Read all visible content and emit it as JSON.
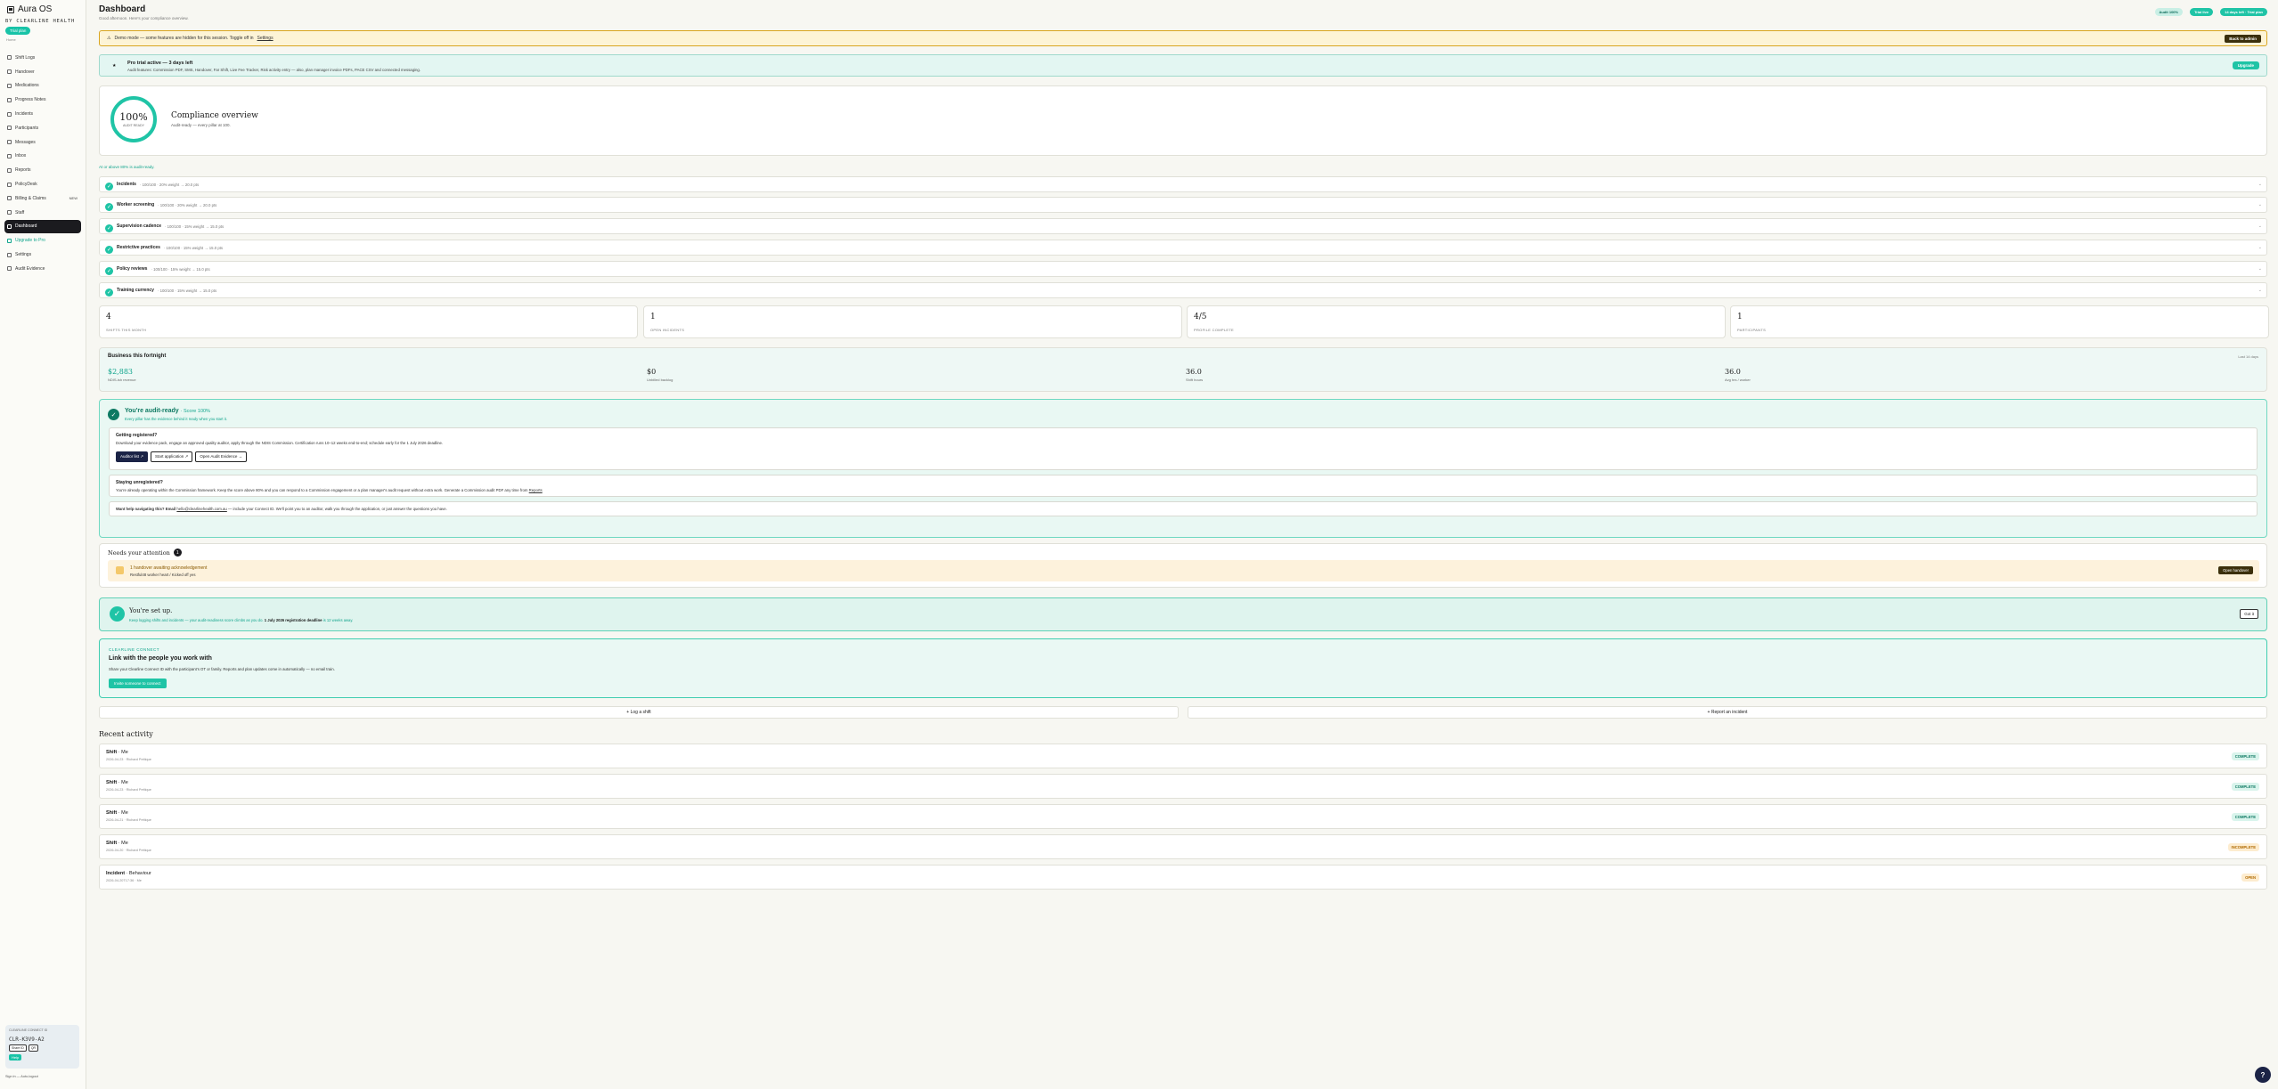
{
  "app": {
    "name": "Aura OS",
    "org": "BY CLEARLINE HEALTH",
    "trial_chip": "Trial plan",
    "section": "Home"
  },
  "sidebar": {
    "items": [
      {
        "label": "Shift Logs"
      },
      {
        "label": "Handover"
      },
      {
        "label": "Medications"
      },
      {
        "label": "Progress Notes"
      },
      {
        "label": "Incidents"
      },
      {
        "label": "Participants"
      },
      {
        "label": "Messages"
      },
      {
        "label": "Inbox"
      },
      {
        "label": "Reports"
      },
      {
        "label": "PolicyDesk"
      },
      {
        "label": "Billing & Claims",
        "badge": "NEW"
      },
      {
        "label": "Staff"
      },
      {
        "label": "Dashboard"
      },
      {
        "label": "Upgrade to Pro"
      },
      {
        "label": "Settings"
      },
      {
        "label": "Audit Evidence"
      }
    ],
    "connect_card": {
      "label": "CLEARLINE CONNECT ID",
      "id": "CLR-K3V9-A2",
      "copy": "Share ID",
      "qr": "QR",
      "help": "Help"
    },
    "footer": "Sign in — Auto-logout"
  },
  "header": {
    "title": "Dashboard",
    "subtitle": "Good afternoon. Here's your compliance overview.",
    "chips": [
      "Audit 100%",
      "Trial live",
      "14 days left · Trial plan"
    ]
  },
  "warning_banner": {
    "text": "Demo mode — some features are hidden for this session. Toggle off in",
    "link": "Settings",
    "button": "Back to admin"
  },
  "trial_banner": {
    "star": "★",
    "title": "Pro trial active — 3 days left",
    "body": "Audit features: Commission PDF, SMS, Handover, Far Shift, Live Fee Tracker, Risk activity entry — also, plan manager invoice PDFs, PACE CSV and connected messaging.",
    "button": "Upgrade"
  },
  "overview": {
    "pct": "100%",
    "ring_label": "AUDIT READY",
    "title": "Compliance overview",
    "subtitle": "Audit-ready — every pillar at 100."
  },
  "above_note": "At or above 80% is audit-ready.",
  "criteria": [
    {
      "name": "Incidents",
      "meta": "· 100/100 · 20% weight → 20.0 pts"
    },
    {
      "name": "Worker screening",
      "meta": "· 100/100 · 20% weight → 20.0 pts"
    },
    {
      "name": "Supervision cadence",
      "meta": "· 100/100 · 15% weight → 15.0 pts"
    },
    {
      "name": "Restrictive practices",
      "meta": "· 100/100 · 15% weight → 15.0 pts"
    },
    {
      "name": "Policy reviews",
      "meta": "· 100/100 · 15% weight → 15.0 pts"
    },
    {
      "name": "Training currency",
      "meta": "· 100/100 · 15% weight → 15.0 pts"
    }
  ],
  "stats": [
    {
      "value": "4",
      "label": "SHIFTS THIS MONTH"
    },
    {
      "value": "1",
      "label": "OPEN INCIDENTS"
    },
    {
      "value": "4/5",
      "label": "PROFILE COMPLETE"
    },
    {
      "value": "1",
      "label": "PARTICIPANTS"
    }
  ],
  "business": {
    "title": "Business this fortnight",
    "range": "Last 14 days",
    "cells": [
      {
        "value": "$2,883",
        "label": "NDIS-ish revenue"
      },
      {
        "value": "$0",
        "label": "Unbilled backlog"
      },
      {
        "value": "36.0",
        "label": "Shift hours"
      },
      {
        "value": "36.0",
        "label": "Avg hrs / worker"
      }
    ]
  },
  "audit_ready": {
    "check": "✓",
    "title": "You're audit-ready",
    "score": "· Score 100%",
    "subtitle": "Every pillar has the evidence behind it ready when you start it.",
    "box1": {
      "title": "Getting registered?",
      "body": "Download your evidence pack, engage an approved quality auditor, apply through the NDIS Commission. Certification runs 10–12 weeks end-to-end; schedule early for the 1 July 2026 deadline.",
      "buttons": [
        "Auditor list ↗",
        "Start application ↗",
        "Open Audit Evidence →"
      ]
    },
    "box2": {
      "title": "Staying unregistered?",
      "body": "You're already operating within the Commission framework. Keep the score above 80% and you can respond to a Commission engagement or a plan manager's audit request without extra work. Generate a Commission audit PDF any time from",
      "link": "Reports"
    },
    "box3": {
      "prefix": "Want help navigating this? Email",
      "email": "hello@clearlinehealth.com.au",
      "suffix": "— include your Connect ID. We'll point you to an auditor, walk you through the application, or just answer the questions you have."
    }
  },
  "attention": {
    "title": "Needs your attention",
    "count": "1",
    "item_title": "1 handover awaiting acknowledgement",
    "item_sub": "Restful48 worker heart / Kicked off yes",
    "button": "Open handover"
  },
  "setup": {
    "check": "✓",
    "title": "You're set up.",
    "body_pre": "Keep logging shifts and incidents — your audit-readiness score climbs as you do.",
    "body_bold": "1 July 2026 registration deadline",
    "body_post": "is 12 weeks away.",
    "button": "Got it"
  },
  "connect": {
    "kicker": "CLEARLINE CONNECT",
    "title": "Link with the people you work with",
    "body": "Share your Clearline Connect ID with the participant's OT or family. Reports and plan updates come in automatically — no email train.",
    "button": "Invite someone to connect"
  },
  "quick": {
    "log": "+ Log a shift",
    "report": "+ Report an incident"
  },
  "recent": {
    "title": "Recent activity",
    "items": [
      {
        "type": "Shift",
        "who": "· Me",
        "meta": "2026-04-23 · Richard Pettique",
        "status": "COMPLETE",
        "cls": "complete"
      },
      {
        "type": "Shift",
        "who": "· Me",
        "meta": "2026-04-23 · Richard Pettique",
        "status": "COMPLETE",
        "cls": "complete"
      },
      {
        "type": "Shift",
        "who": "· Me",
        "meta": "2026-04-21 · Richard Pettique",
        "status": "COMPLETE",
        "cls": "complete"
      },
      {
        "type": "Shift",
        "who": "· Me",
        "meta": "2026-04-20 · Richard Pettique",
        "status": "INCOMPLETE",
        "cls": "incomplete"
      },
      {
        "type": "Incident",
        "who": "· Behaviour",
        "meta": "2026-04-20T17:36 · Me",
        "status": "OPEN",
        "cls": "open"
      }
    ]
  },
  "fab": "?",
  "colors": {
    "accent": "#1fc4a6",
    "accent_dark": "#0e7a63",
    "warning_border": "#d9a520"
  }
}
